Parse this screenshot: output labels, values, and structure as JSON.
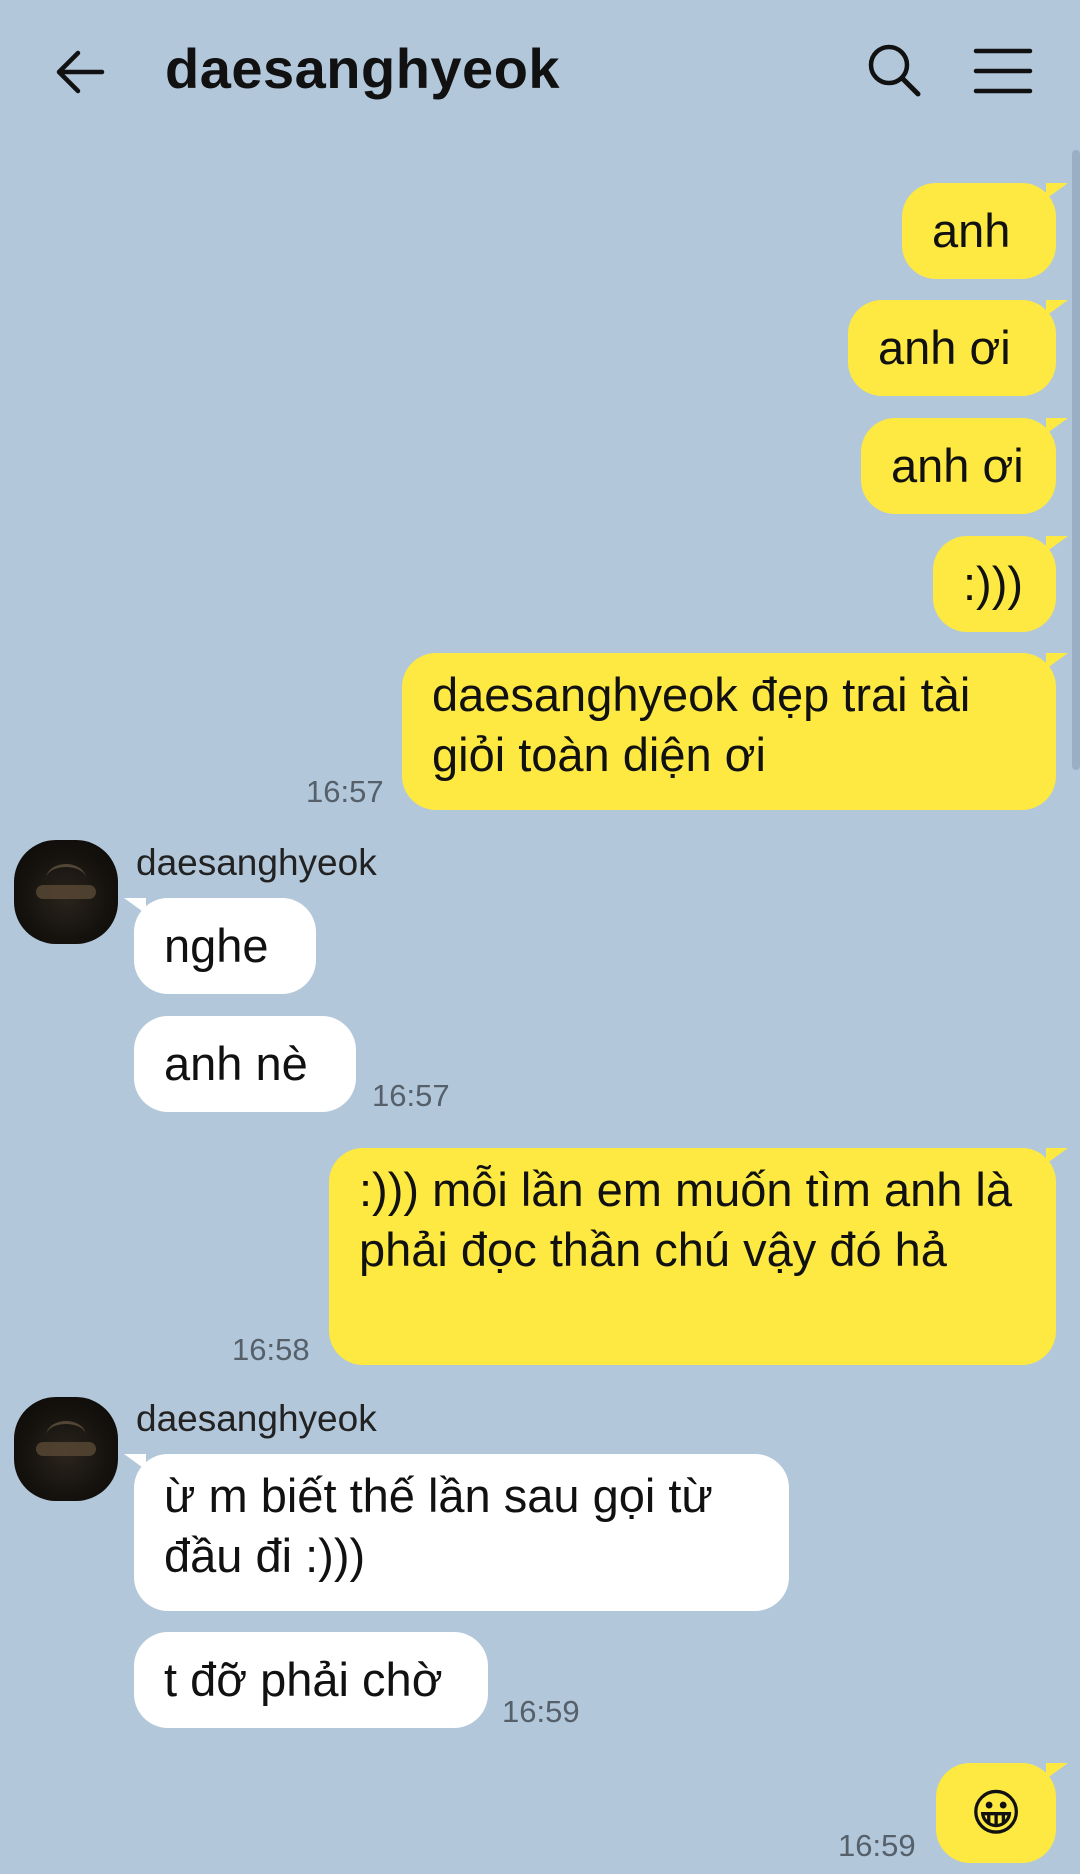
{
  "header": {
    "title": "daesanghyeok",
    "back_icon": "arrow-left-icon",
    "search_icon": "search-icon",
    "menu_icon": "hamburger-menu-icon"
  },
  "colors": {
    "background": "#b2c7da",
    "outgoing_bubble": "#fde941",
    "incoming_bubble": "#ffffff"
  },
  "messages": [
    {
      "direction": "out",
      "text": "anh",
      "time": ""
    },
    {
      "direction": "out",
      "text": "anh ơi",
      "time": ""
    },
    {
      "direction": "out",
      "text": "anh ơi",
      "time": ""
    },
    {
      "direction": "out",
      "text": ":)))",
      "time": ""
    },
    {
      "direction": "out",
      "text": "daesanghyeok đẹp trai tài giỏi toàn diện ơi",
      "time": "16:57"
    },
    {
      "direction": "in",
      "sender": "daesanghyeok",
      "text": "nghe",
      "time": ""
    },
    {
      "direction": "in",
      "text": "anh nè",
      "time": "16:57"
    },
    {
      "direction": "out",
      "text": ":))) mỗi lần em muốn tìm anh là phải đọc thần chú vậy đó hả",
      "time": "16:58"
    },
    {
      "direction": "in",
      "sender": "daesanghyeok",
      "text": "ừ m biết thế lần sau gọi từ đầu đi :)))",
      "time": ""
    },
    {
      "direction": "in",
      "text": "t đỡ phải chờ",
      "time": "16:59"
    },
    {
      "direction": "out",
      "text": "😀",
      "time": "16:59"
    }
  ]
}
